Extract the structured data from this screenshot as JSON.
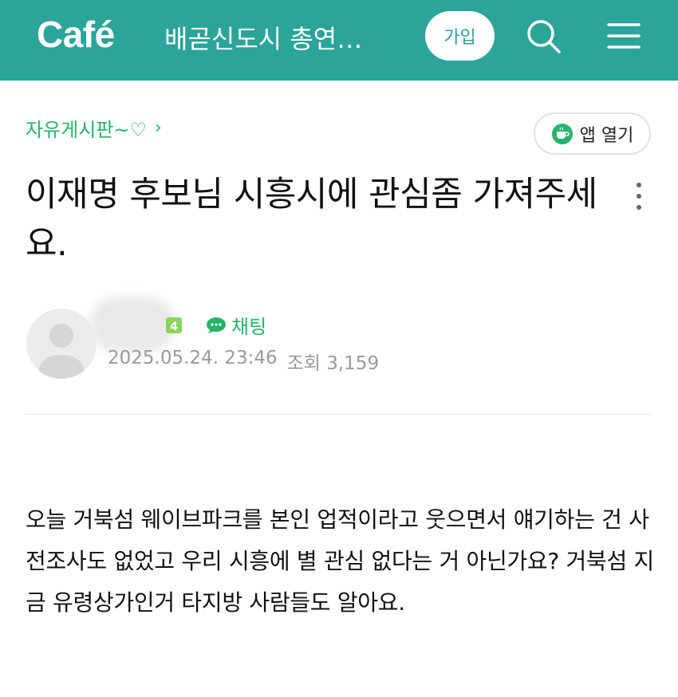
{
  "header": {
    "logo": "Café",
    "cafe_name": "배곧신도시 총연…",
    "join_label": "가입",
    "icons": {
      "search": "search-icon",
      "menu": "menu-icon"
    },
    "background_color": "#2ba49a"
  },
  "board": {
    "name": "자유게시판~♡",
    "chevron": "›",
    "app_open_label": "앱 열기"
  },
  "post": {
    "title": "이재명 후보님 시흥시에 관심좀 가져주세요.",
    "author": {
      "level": "4",
      "chat_label": "채팅",
      "date": "2025.05.24. 23:46",
      "views_label": "조회",
      "views": "3,159"
    },
    "body": "오늘 거북섬 웨이브파크를 본인 업적이라고 웃으면서 얘기하는 건 사전조사도 없었고 우리 시흥에 별 관심 없다는 거 아닌가요? 거북섬 지금 유령상가인거 타지방 사람들도 알아요."
  },
  "colors": {
    "accent_green": "#25b36a",
    "meta_gray": "#9a9a9a"
  }
}
